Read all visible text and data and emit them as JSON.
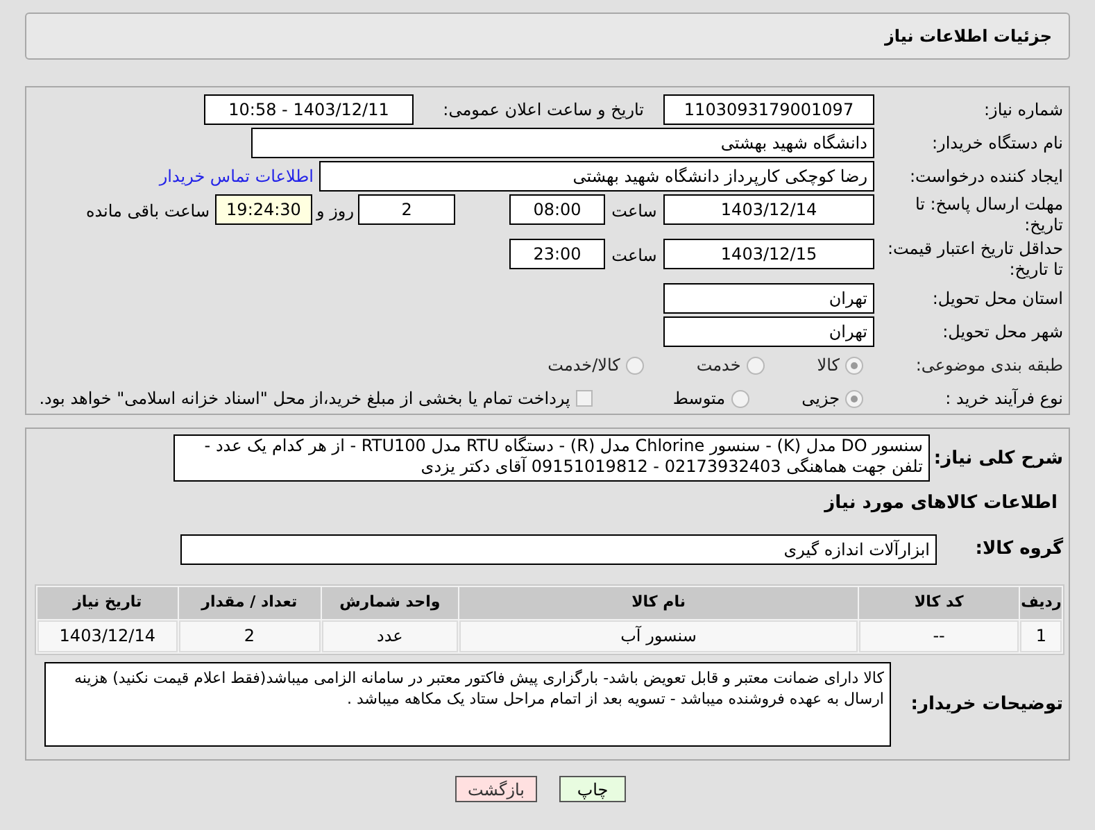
{
  "page_title": "جزئیات اطلاعات نیاز",
  "need_number": {
    "label": "شماره نیاز:",
    "value": "1103093179001097"
  },
  "announce": {
    "label": "تاریخ و ساعت اعلان عمومی:",
    "value": "1403/12/11 - 10:58"
  },
  "buyer_org": {
    "label": "نام دستگاه خریدار:",
    "value": "دانشگاه شهید بهشتی"
  },
  "requester": {
    "label": "ایجاد کننده درخواست:",
    "value": "رضا کوچکی کارپرداز دانشگاه شهید بهشتی",
    "link": "اطلاعات تماس خریدار"
  },
  "deadline": {
    "label": "مهلت ارسال پاسخ: تا تاریخ:",
    "date": "1403/12/14",
    "time_label": "ساعت",
    "time": "08:00",
    "days": "2",
    "days_label": "روز و",
    "remaining": "19:24:30",
    "remaining_label": "ساعت باقی مانده"
  },
  "price_validity": {
    "label": "حداقل تاریخ اعتبار قیمت: تا تاریخ:",
    "date": "1403/12/15",
    "time_label": "ساعت",
    "time": "23:00"
  },
  "province": {
    "label": "استان محل تحویل:",
    "value": "تهران"
  },
  "city": {
    "label": "شهر محل تحویل:",
    "value": "تهران"
  },
  "category": {
    "label": "طبقه بندی موضوعی:",
    "options": [
      {
        "label": "کالا",
        "selected": true
      },
      {
        "label": "خدمت",
        "selected": false
      },
      {
        "label": "کالا/خدمت",
        "selected": false
      }
    ]
  },
  "process": {
    "label": "نوع فرآیند خرید :",
    "options": [
      {
        "label": "جزیی",
        "selected": true
      },
      {
        "label": "متوسط",
        "selected": false
      }
    ],
    "treasury": {
      "label": "پرداخت تمام یا بخشی از مبلغ خرید،از محل \"اسناد خزانه اسلامی\" خواهد بود.",
      "checked": false
    }
  },
  "description": {
    "label": "شرح کلی نیاز:",
    "value": "سنسور DO مدل (K) - سنسور Chlorine مدل (R) - دستگاه RTU مدل RTU100 - از هر کدام یک عدد - تلفن جهت هماهنگی 02173932403 - 09151019812 آقای دکتر یزدی"
  },
  "goods_heading": "اطلاعات کالاهای مورد نیاز",
  "goods_group": {
    "label": "گروه کالا:",
    "value": "ابزارآلات اندازه گیری"
  },
  "table": {
    "columns": [
      "ردیف",
      "کد کالا",
      "نام کالا",
      "واحد شمارش",
      "تعداد / مقدار",
      "تاریخ نیاز"
    ],
    "rows": [
      [
        "1",
        "--",
        "سنسور آب",
        "عدد",
        "2",
        "1403/12/14"
      ]
    ]
  },
  "buyer_notes": {
    "label": "توضیحات خریدار:",
    "value": "کالا دارای ضمانت معتبر و قابل تعویض باشد- بارگزاری پیش فاکتور معتبر در سامانه الزامی میباشد(فقط اعلام قیمت نکنید) هزینه ارسال به عهده فروشنده میباشد - تسویه بعد از اتمام مراحل ستاد یک مکاهه میباشد ."
  },
  "buttons": [
    {
      "label": "چاپ",
      "kind": "print"
    },
    {
      "label": "بازگشت",
      "kind": "back"
    }
  ]
}
